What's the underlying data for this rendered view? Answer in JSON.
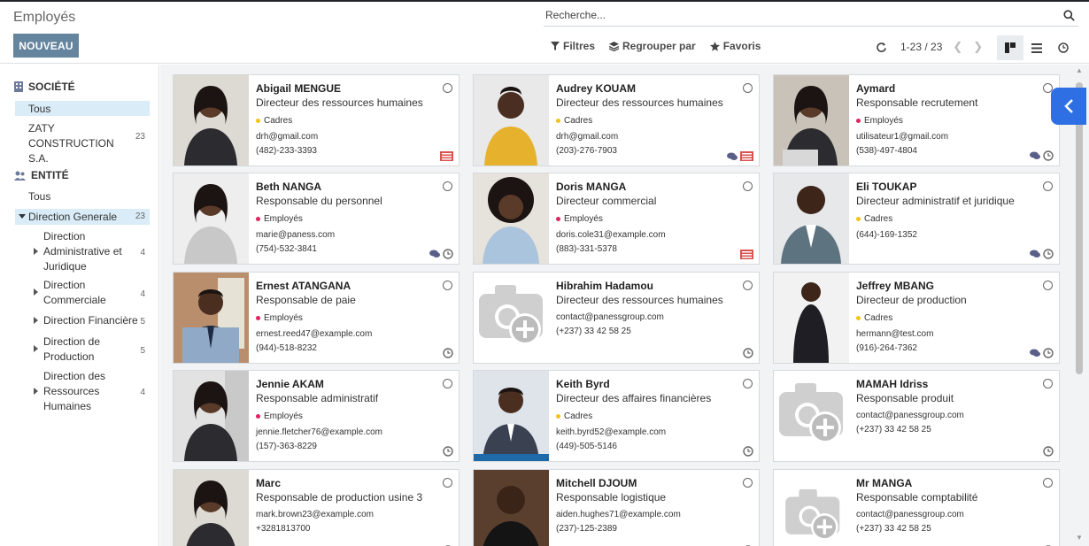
{
  "header": {
    "title": "Employés",
    "new_button": "NOUVEAU",
    "search_placeholder": "Recherche...",
    "filters_label": "Filtres",
    "group_label": "Regrouper par",
    "favorites_label": "Favoris",
    "pager": "1-23 / 23"
  },
  "sidebar": {
    "company_header": "SOCIÉTÉ",
    "company_all": "Tous",
    "company_name": "ZATY CONSTRUCTION S.A.",
    "company_count": "23",
    "entity_header": "ENTITÉ",
    "entity_all": "Tous",
    "entity_main": "Direction Generale",
    "entity_main_count": "23",
    "subs": [
      {
        "label": "Direction Administrative et Juridique",
        "count": "4"
      },
      {
        "label": "Direction Commerciale",
        "count": "4"
      },
      {
        "label": "Direction Financière",
        "count": "5"
      },
      {
        "label": "Direction de Production",
        "count": "5"
      },
      {
        "label": "Direction des Ressources Humaines",
        "count": "4"
      }
    ]
  },
  "colors": {
    "cadres": "#f0c419",
    "employes": "#e0245e",
    "accent": "#65849e"
  },
  "employees": [
    {
      "name": "Abigail MENGUE",
      "job": "Directeur des ressources humaines",
      "tag": "Cadres",
      "email": "drh@gmail.com",
      "phone": "(482)-233-3393"
    },
    {
      "name": "Audrey KOUAM",
      "job": "Directeur des ressources humaines",
      "tag": "Cadres",
      "email": "drh@gmail.com",
      "phone": "(203)-276-7903"
    },
    {
      "name": "Aymard",
      "job": "Responsable recrutement",
      "tag": "Employés",
      "email": "utilisateur1@gmail.com",
      "phone": "(538)-497-4804"
    },
    {
      "name": "Beth NANGA",
      "job": "Responsable du personnel",
      "tag": "Employés",
      "email": "marie@paness.com",
      "phone": "(754)-532-3841"
    },
    {
      "name": "Doris MANGA",
      "job": "Directeur commercial",
      "tag": "Employés",
      "email": "doris.cole31@example.com",
      "phone": "(883)-331-5378"
    },
    {
      "name": "Eli TOUKAP",
      "job": "Directeur administratif et juridique",
      "tag": "Cadres",
      "email": "",
      "phone": "(644)-169-1352"
    },
    {
      "name": "Ernest ATANGANA",
      "job": "Responsable de paie",
      "tag": "Employés",
      "email": "ernest.reed47@example.com",
      "phone": "(944)-518-8232"
    },
    {
      "name": "Hibrahim Hadamou",
      "job": "Directeur des ressources humaines",
      "tag": "",
      "email": "contact@panessgroup.com",
      "phone": "(+237) 33 42 58 25"
    },
    {
      "name": "Jeffrey MBANG",
      "job": "Directeur de production",
      "tag": "Cadres",
      "email": "hermann@test.com",
      "phone": "(916)-264-7362"
    },
    {
      "name": "Jennie AKAM",
      "job": "Responsable administratif",
      "tag": "Employés",
      "email": "jennie.fletcher76@example.com",
      "phone": "(157)-363-8229"
    },
    {
      "name": "Keith Byrd",
      "job": "Directeur des affaires financières",
      "tag": "Cadres",
      "email": "keith.byrd52@example.com",
      "phone": "(449)-505-5146"
    },
    {
      "name": "MAMAH Idriss",
      "job": "Responsable produit",
      "tag": "",
      "email": "contact@panessgroup.com",
      "phone": "(+237) 33 42 58 25"
    },
    {
      "name": "Marc",
      "job": "Responsable de production usine 3",
      "tag": "",
      "email": "mark.brown23@example.com",
      "phone": "+3281813700"
    },
    {
      "name": "Mitchell DJOUM",
      "job": "Responsable logistique",
      "tag": "",
      "email": "aiden.hughes71@example.com",
      "phone": "(237)-125-2389"
    },
    {
      "name": "Mr MANGA",
      "job": "Responsable comptabilité",
      "tag": "",
      "email": "contact@panessgroup.com",
      "phone": "(+237) 33 42 58 25"
    }
  ]
}
